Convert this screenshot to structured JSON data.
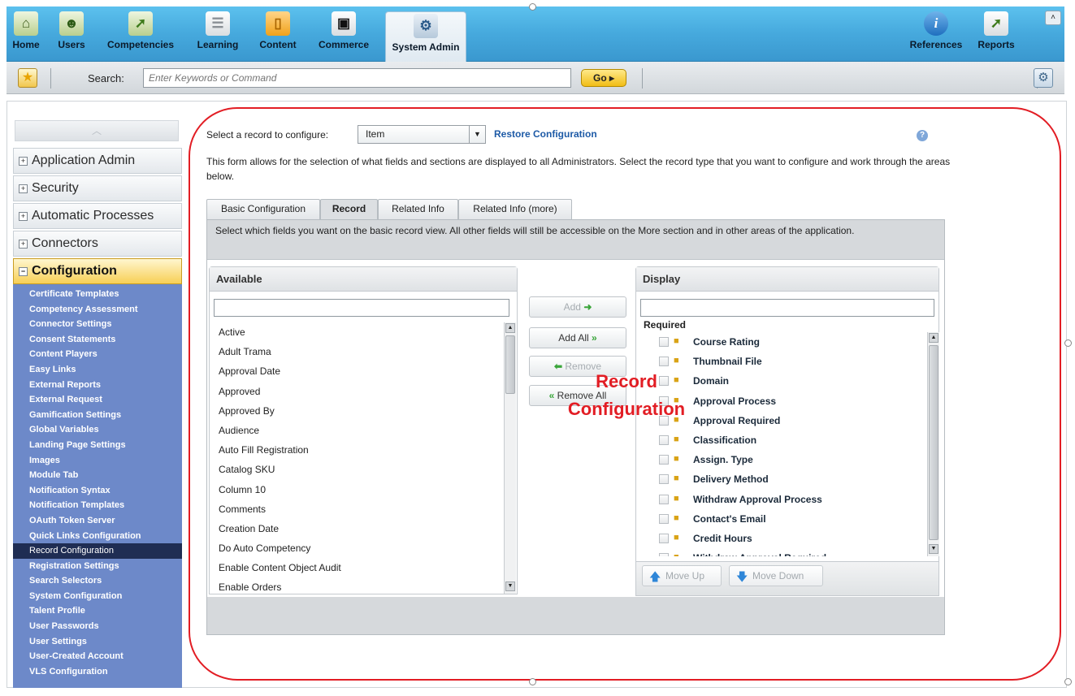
{
  "nav": {
    "items": [
      {
        "label": "Home",
        "icon": "home-icon"
      },
      {
        "label": "Users",
        "icon": "users-icon"
      },
      {
        "label": "Competencies",
        "icon": "competencies-icon"
      },
      {
        "label": "Learning",
        "icon": "learning-icon"
      },
      {
        "label": "Content",
        "icon": "folder-icon"
      },
      {
        "label": "Commerce",
        "icon": "briefcase-icon"
      },
      {
        "label": "System Admin",
        "icon": "admin-icon"
      }
    ],
    "right_items": [
      {
        "label": "References",
        "icon": "info-icon"
      },
      {
        "label": "Reports",
        "icon": "reports-icon"
      }
    ],
    "active": "System Admin",
    "collapse_glyph": "˄"
  },
  "searchbar": {
    "label": "Search:",
    "placeholder": "Enter Keywords or Command",
    "go_label": "Go ▸"
  },
  "sidebar": {
    "scroll_up_glyph": "︿",
    "sections": [
      {
        "label": "Application Admin",
        "expanded": false
      },
      {
        "label": "Security",
        "expanded": false
      },
      {
        "label": "Automatic Processes",
        "expanded": false
      },
      {
        "label": "Connectors",
        "expanded": false
      },
      {
        "label": "Configuration",
        "expanded": true
      }
    ],
    "configuration_items": [
      "Certificate Templates",
      "Competency Assessment",
      "Connector Settings",
      "Consent Statements",
      "Content Players",
      "Easy Links",
      "External Reports",
      "External Request",
      "Gamification Settings",
      "Global Variables",
      "Landing Page Settings",
      "Images",
      "Module Tab",
      "Notification Syntax",
      "Notification Templates",
      "OAuth Token Server",
      "Quick Links Configuration",
      "Record Configuration",
      "Registration Settings",
      "Search Selectors",
      "System Configuration",
      "Talent Profile",
      "User Passwords",
      "User Settings",
      "User-Created Account",
      "VLS Configuration"
    ],
    "selected_item": "Record Configuration"
  },
  "form": {
    "select_label": "Select a record to configure:",
    "record_value": "Item",
    "restore_link": "Restore Configuration",
    "help_glyph": "?",
    "intro": "This form allows for the selection of what fields and sections are displayed to all Administrators.  Select the record type that you want to configure and work through the areas below."
  },
  "tabs": {
    "items": [
      "Basic Configuration",
      "Record",
      "Related Info",
      "Related Info (more)"
    ],
    "active": "Record",
    "description": "Select which fields you want on the basic record view. All other fields will still be accessible on the More section and in other areas of the application."
  },
  "available": {
    "title": "Available",
    "filter_value": "",
    "items": [
      "Active",
      "Adult Trama",
      "Approval Date",
      "Approved",
      "Approved By",
      "Audience",
      "Auto Fill Registration",
      "Catalog SKU",
      "Column 10",
      "Comments",
      "Creation Date",
      "Do Auto Competency",
      "Enable Content Object Audit",
      "Enable Orders"
    ]
  },
  "middle_buttons": {
    "add": "Add",
    "add_all": "Add All",
    "remove": "Remove",
    "remove_all": "Remove All"
  },
  "display": {
    "title": "Display",
    "filter_value": "",
    "group_label": "Required",
    "items": [
      "Course Rating",
      "Thumbnail File",
      "Domain",
      "Approval Process",
      "Approval Required",
      "Classification",
      "Assign. Type",
      "Delivery Method",
      "Withdraw Approval Process",
      "Contact's Email",
      "Credit Hours",
      "Withdraw Approval Required"
    ],
    "move_up": "Move Up",
    "move_down": "Move Down"
  },
  "annotation": {
    "line1": "Record",
    "line2": "Configuration",
    "color": "#e21d24"
  },
  "colors": {
    "nav_blue": "#46a9dd",
    "sidebar_list": "#6d89c9",
    "selected_item": "#1f2d53",
    "open_section": "#f7cf56",
    "link": "#1d5aa6"
  }
}
